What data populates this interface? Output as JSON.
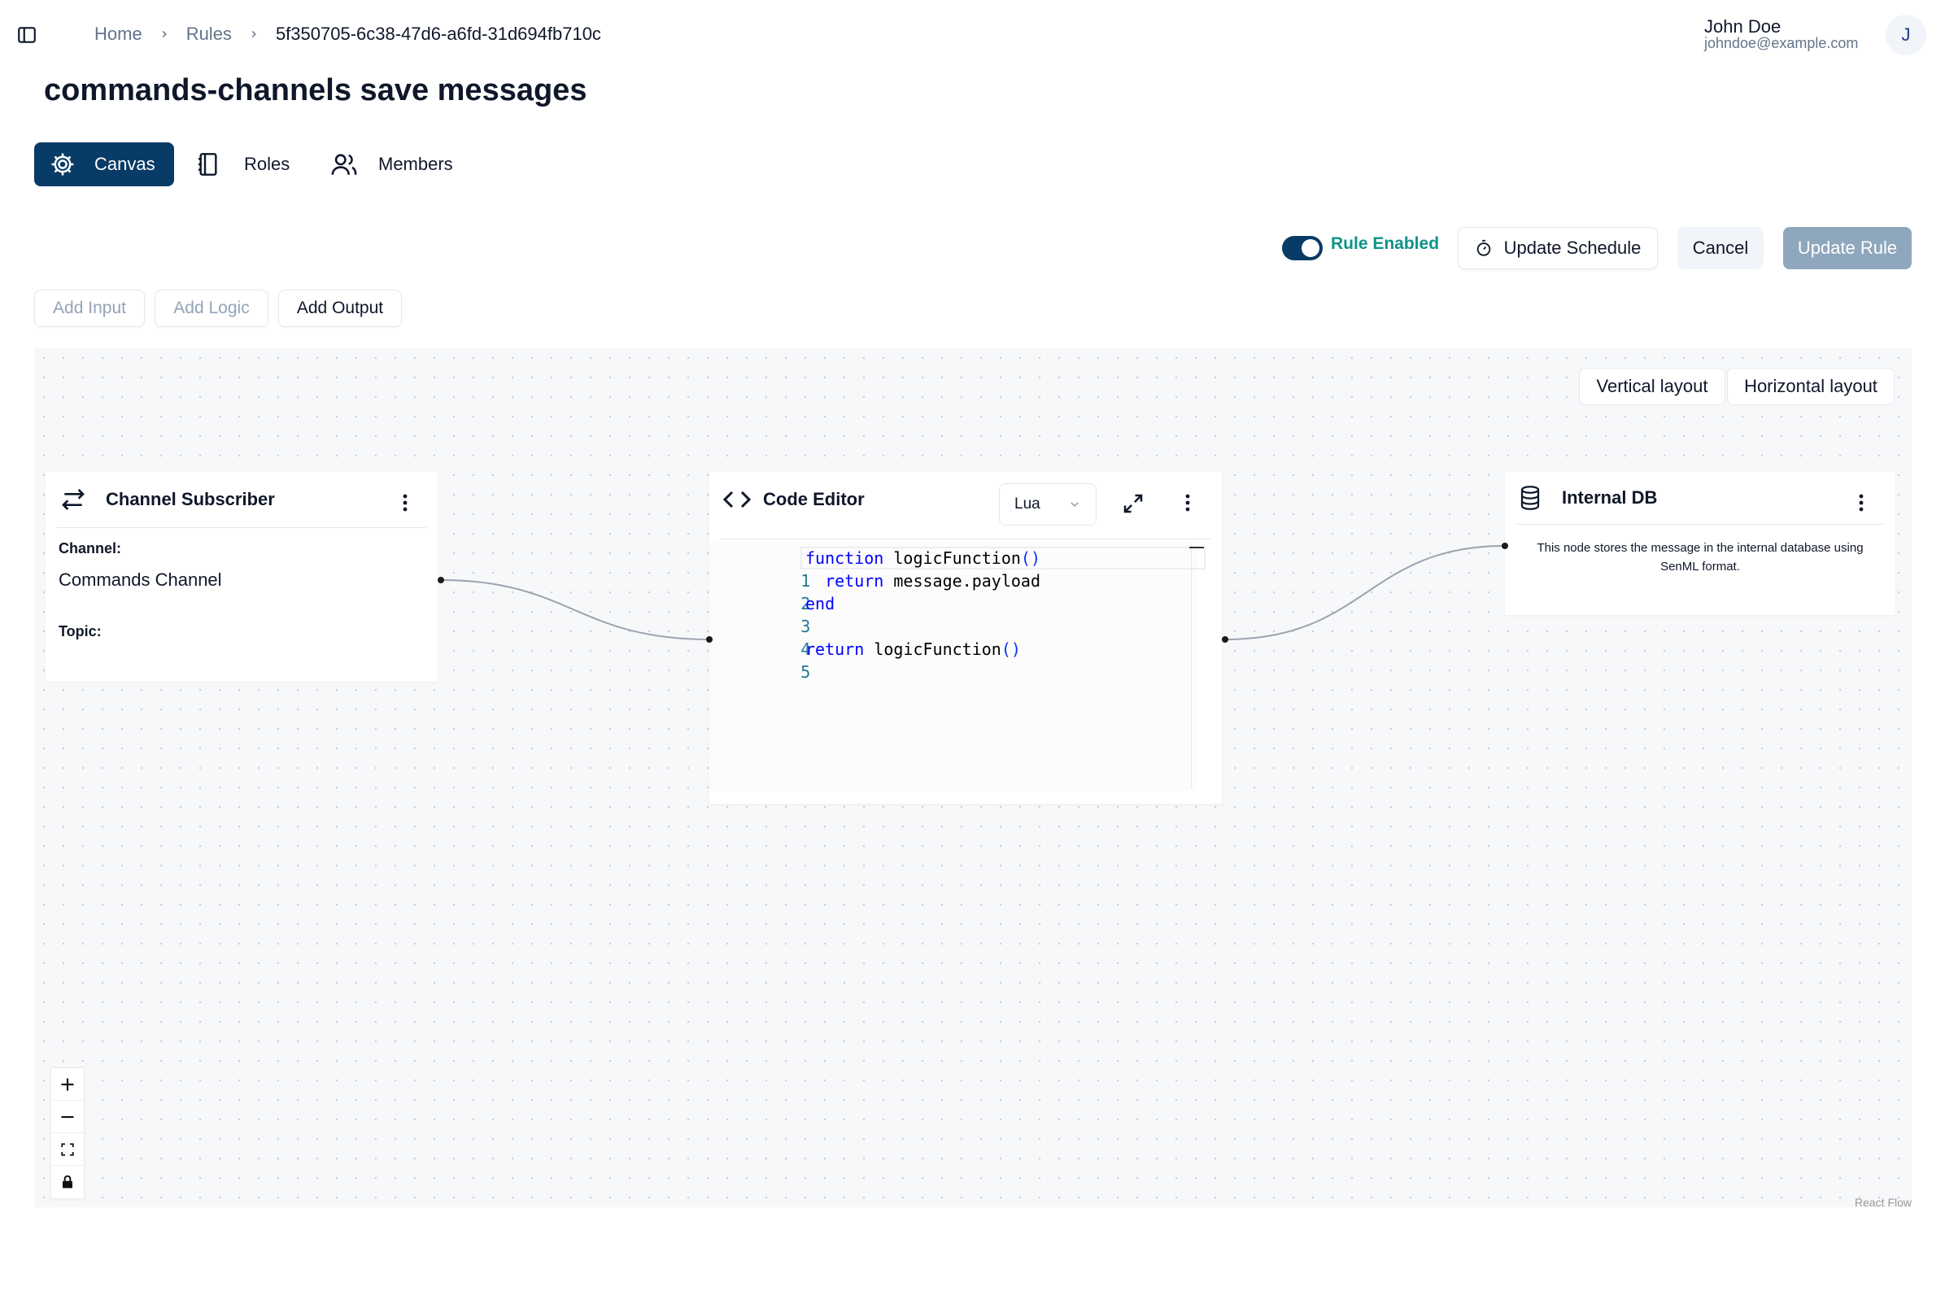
{
  "breadcrumb": {
    "items": [
      "Home",
      "Rules"
    ],
    "current": "5f350705-6c38-47d6-a6fd-31d694fb710c"
  },
  "user": {
    "name": "John Doe",
    "email": "johndoe@example.com",
    "initial": "J"
  },
  "page": {
    "title": "commands-channels save messages"
  },
  "tabs": [
    {
      "label": "Canvas",
      "icon": "gear-icon",
      "active": true
    },
    {
      "label": "Roles",
      "icon": "notebook-icon",
      "active": false
    },
    {
      "label": "Members",
      "icon": "users-icon",
      "active": false
    }
  ],
  "actions": {
    "toggle_label": "Rule Enabled",
    "toggle_on": true,
    "update_schedule": "Update Schedule",
    "cancel": "Cancel",
    "update_rule": "Update Rule"
  },
  "add_buttons": {
    "add_input": "Add Input",
    "add_logic": "Add Logic",
    "add_output": "Add Output"
  },
  "layout_buttons": {
    "vertical": "Vertical layout",
    "horizontal": "Horizontal layout"
  },
  "nodes": {
    "subscriber": {
      "title": "Channel Subscriber",
      "channel_label": "Channel:",
      "channel_value": "Commands Channel",
      "topic_label": "Topic:"
    },
    "code_editor": {
      "title": "Code Editor",
      "language": "Lua",
      "line_numbers": [
        "1",
        "2",
        "3",
        "4",
        "5"
      ]
    },
    "internal_db": {
      "title": "Internal DB",
      "description": "This node stores the message in the internal database using SenML format."
    }
  },
  "attribution": "React Flow",
  "colors": {
    "primary": "#083b66",
    "enabled_text": "#0d9488",
    "disabled_button": "#8ea7bd",
    "canvas_bg": "#f7f8fa"
  }
}
